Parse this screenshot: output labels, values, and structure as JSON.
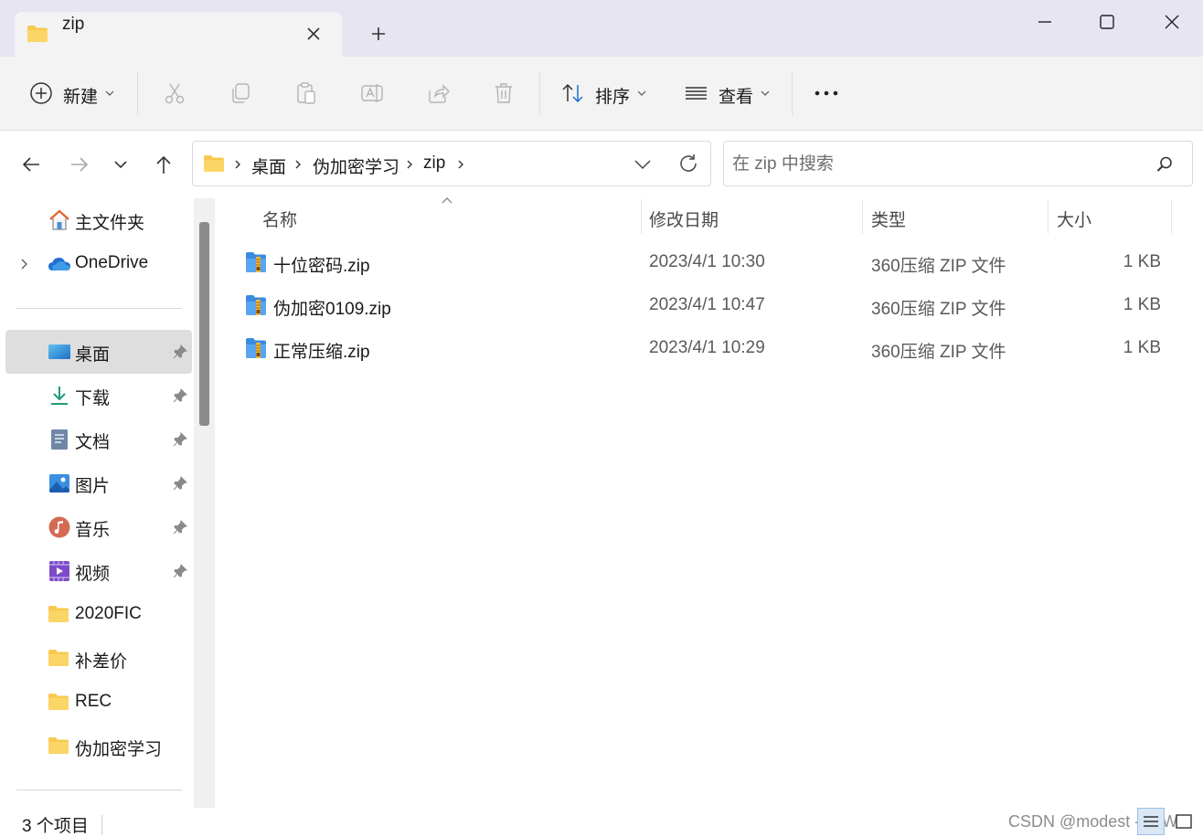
{
  "window": {
    "tab_title": "zip"
  },
  "toolbar": {
    "new_label": "新建",
    "sort_label": "排序",
    "view_label": "查看"
  },
  "address": {
    "crumbs": [
      "桌面",
      "伪加密学习",
      "zip"
    ]
  },
  "search": {
    "placeholder": "在 zip 中搜索"
  },
  "sidebar": {
    "home": "主文件夹",
    "onedrive": "OneDrive",
    "items": [
      {
        "label": "桌面",
        "icon": "desktop-icon",
        "pinned": true,
        "selected": true
      },
      {
        "label": "下载",
        "icon": "download-icon",
        "pinned": true
      },
      {
        "label": "文档",
        "icon": "document-icon",
        "pinned": true
      },
      {
        "label": "图片",
        "icon": "pictures-icon",
        "pinned": true
      },
      {
        "label": "音乐",
        "icon": "music-icon",
        "pinned": true
      },
      {
        "label": "视频",
        "icon": "video-icon",
        "pinned": true
      },
      {
        "label": "2020FIC",
        "icon": "folder-icon"
      },
      {
        "label": "补差价",
        "icon": "folder-icon"
      },
      {
        "label": "REC",
        "icon": "folder-icon"
      },
      {
        "label": "伪加密学习",
        "icon": "folder-icon"
      }
    ]
  },
  "columns": {
    "name": "名称",
    "date": "修改日期",
    "type": "类型",
    "size": "大小"
  },
  "files": [
    {
      "name": "十位密码.zip",
      "date": "2023/4/1 10:30",
      "type": "360压缩 ZIP 文件",
      "size": "1 KB"
    },
    {
      "name": "伪加密0109.zip",
      "date": "2023/4/1 10:47",
      "type": "360压缩 ZIP 文件",
      "size": "1 KB"
    },
    {
      "name": "正常压缩.zip",
      "date": "2023/4/1 10:29",
      "type": "360压缩 ZIP 文件",
      "size": "1 KB"
    }
  ],
  "status": {
    "count": "3 个项目",
    "watermark": "CSDN @modest -YBW"
  },
  "colors": {
    "titlebar": "#e6e5f1",
    "toolbar": "#f3f3f3",
    "selected": "#dedede",
    "folder": "#f8c94f"
  }
}
